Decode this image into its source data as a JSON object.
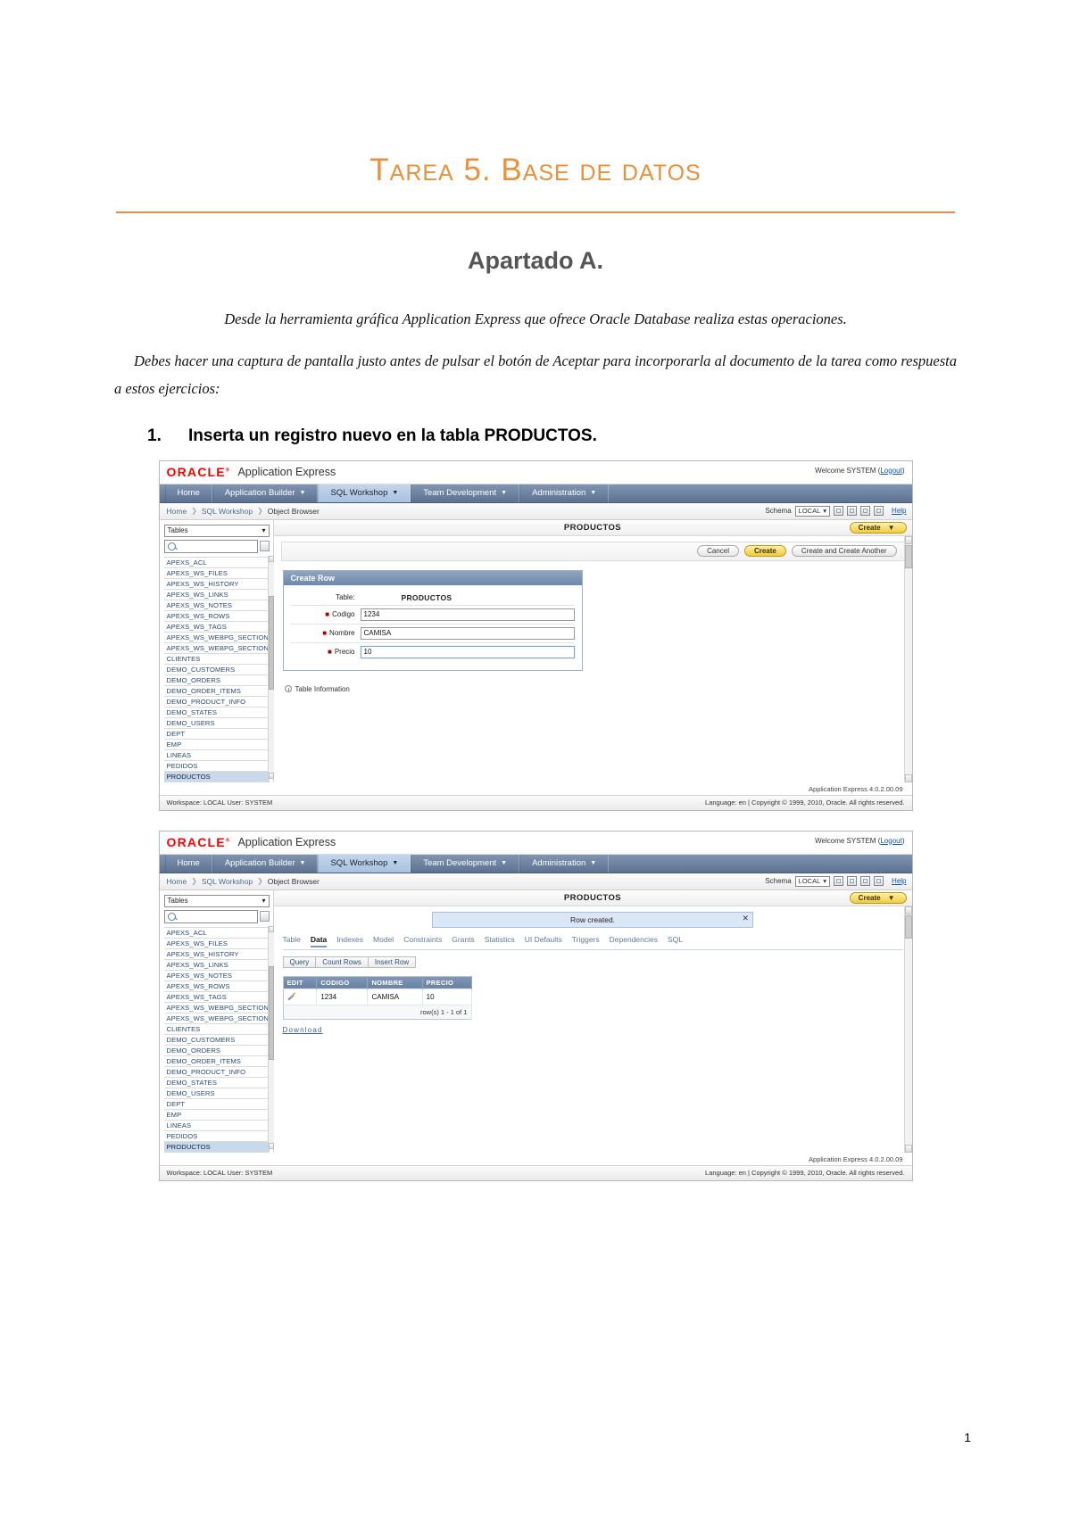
{
  "document": {
    "title": "Tarea 5. Base de datos",
    "subtitle": "Apartado A.",
    "paragraph1": "Desde la herramienta gráfica Application Express que ofrece Oracle Database realiza estas operaciones.",
    "paragraph2": "Debes hacer una captura de pantalla justo antes de pulsar el botón de Aceptar para  incorporarla al documento de la tarea como respuesta a estos ejercicios:",
    "list_number": "1.",
    "list_item": "Inserta un registro nuevo en la tabla PRODUCTOS.",
    "page_number": "1",
    "accent_color": "#E8913A"
  },
  "apex": {
    "brand": "ORACLE",
    "brand_sup": "®",
    "product": "Application Express",
    "welcome": "Welcome SYSTEM",
    "logout": "Logout",
    "welcome_open": "(",
    "welcome_close": ")",
    "nav": [
      {
        "label": "Home",
        "has_caret": false,
        "active": false
      },
      {
        "label": "Application Builder",
        "has_caret": true,
        "active": false
      },
      {
        "label": "SQL Workshop",
        "has_caret": true,
        "active": true
      },
      {
        "label": "Team Development",
        "has_caret": true,
        "active": false
      },
      {
        "label": "Administration",
        "has_caret": true,
        "active": false
      }
    ],
    "breadcrumb": [
      "Home",
      "SQL Workshop",
      "Object Browser"
    ],
    "schema_label": "Schema",
    "schema_value": "LOCAL",
    "help_label": "Help",
    "sidebar": {
      "object_type": "Tables",
      "search_value": "",
      "tables": [
        "APEXS_ACL",
        "APEXS_WS_FILES",
        "APEXS_WS_HISTORY",
        "APEXS_WS_LINKS",
        "APEXS_WS_NOTES",
        "APEXS_WS_ROWS",
        "APEXS_WS_TAGS",
        "APEXS_WS_WEBPG_SECTIONS",
        "APEXS_WS_WEBPG_SECTION_HI",
        "CLIENTES",
        "DEMO_CUSTOMERS",
        "DEMO_ORDERS",
        "DEMO_ORDER_ITEMS",
        "DEMO_PRODUCT_INFO",
        "DEMO_STATES",
        "DEMO_USERS",
        "DEPT",
        "EMP",
        "LINEAS",
        "PEDIDOS",
        "PRODUCTOS"
      ],
      "selected_table": "PRODUCTOS"
    },
    "object_title": "PRODUCTOS",
    "create_button": "Create",
    "version": "Application Express 4.0.2.00.09",
    "footer_left": "Workspace: LOCAL User: SYSTEM",
    "footer_right": "Language: en | Copyright © 1999, 2010, Oracle. All rights reserved."
  },
  "screen1": {
    "toolbar_buttons": [
      "Cancel",
      "Create",
      "Create and Create Another"
    ],
    "panel_title": "Create Row",
    "table_label": "Table:",
    "table_value": "PRODUCTOS",
    "fields": [
      {
        "label": "Codigo",
        "value": "1234",
        "required": true,
        "focused": false
      },
      {
        "label": "Nombre",
        "value": "CAMISA",
        "required": true,
        "focused": false
      },
      {
        "label": "Precio",
        "value": "10",
        "required": true,
        "focused": true
      }
    ],
    "table_information": "Table Information"
  },
  "screen2": {
    "message": "Row created.",
    "message_close": "✕",
    "tabs": [
      {
        "label": "Table",
        "active": false
      },
      {
        "label": "Data",
        "active": true
      },
      {
        "label": "Indexes",
        "active": false
      },
      {
        "label": "Model",
        "active": false
      },
      {
        "label": "Constraints",
        "active": false
      },
      {
        "label": "Grants",
        "active": false
      },
      {
        "label": "Statistics",
        "active": false
      },
      {
        "label": "UI Defaults",
        "active": false
      },
      {
        "label": "Triggers",
        "active": false
      },
      {
        "label": "Dependencies",
        "active": false
      },
      {
        "label": "SQL",
        "active": false
      }
    ],
    "action_buttons": [
      "Query",
      "Count Rows",
      "Insert Row"
    ],
    "grid": {
      "columns": [
        "EDIT",
        "CODIGO",
        "NOMBRE",
        "PRECIO"
      ],
      "rows": [
        {
          "edit": "",
          "codigo": "1234",
          "nombre": "CAMISA",
          "precio": "10"
        }
      ],
      "row_count": "row(s) 1 - 1 of 1"
    },
    "download_label": "Download"
  }
}
